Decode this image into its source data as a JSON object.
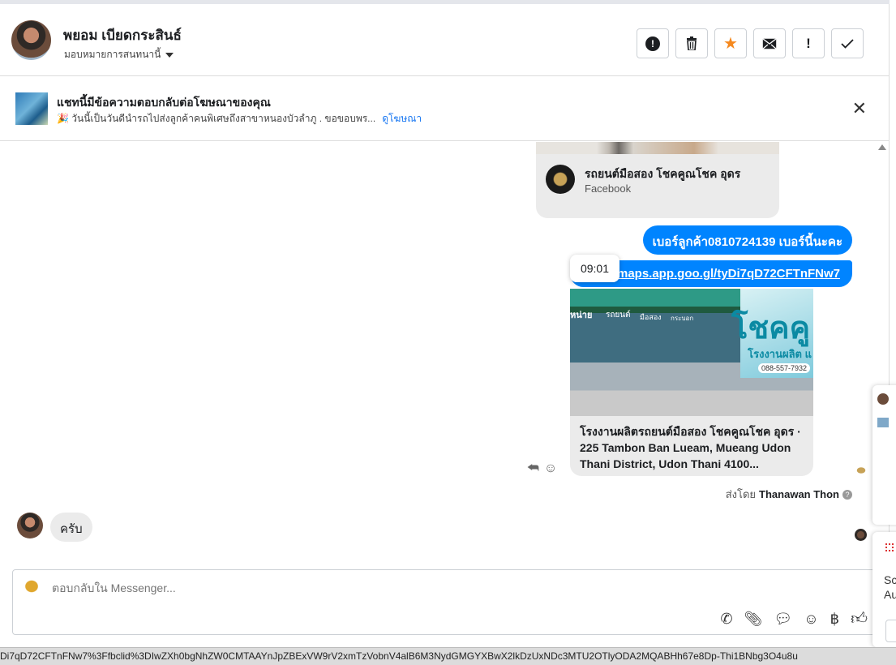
{
  "header": {
    "name": "พยอม เบียดกระสินธ์",
    "assign_label": "มอบหมายการสนทนานี้",
    "actions": [
      {
        "icon": "alert-circle-icon",
        "glyph": "❗"
      },
      {
        "icon": "trash-icon",
        "glyph": "🗑"
      },
      {
        "icon": "star-icon",
        "glyph": "★"
      },
      {
        "icon": "envelope-icon",
        "glyph": "✉"
      },
      {
        "icon": "exclamation-icon",
        "glyph": "!"
      },
      {
        "icon": "check-icon",
        "glyph": "✓"
      }
    ]
  },
  "ad_banner": {
    "title": "แชทนี้มีข้อความตอบกลับต่อโฆษณาของคุณ",
    "text": "🎉 วันนี้เป็นวันดีนำรถไปส่งลูกค้าคนพิเศษถึงสาขาหนองบัวลำภู . ขอขอบพร...",
    "link": "ดูโฆษณา",
    "close": "✕"
  },
  "messages": {
    "card_title": "รถยนต์มือสอง โชคคูณโชค อุดร",
    "card_source": "Facebook",
    "msg_phone": "เบอร์ลูกค้า0810724139 เบอร์นี้นะคะ",
    "msg_link": "https://maps.app.goo.gl/tyDi7qD72CFTnFNw7",
    "tooltip_time": "09:01",
    "link_card_desc": "โรงงานผลิตรถยนต์มือสอง โชคคูณโชค อุดร · 225 Tambon Ban Lueam, Mueang Udon Thani District, Udon Thani 4100...",
    "img_sign_text": "โชคคู",
    "img_sign_sub": "โรงงานผลิต แ",
    "img_phone": "088-557-7932",
    "img_store_labels": [
      "หน่าย",
      "รถยนต์",
      "มือสอง",
      "กระบอก"
    ],
    "sent_by_prefix": "ส่งโดย",
    "sent_by_name": "Thanawan Thon",
    "help": "?",
    "incoming_reply": "ครับ"
  },
  "composer": {
    "placeholder": "ตอบกลับใน Messenger..."
  },
  "status_bar": {
    "url_text": "Di7qD72CFTnFNw7%3Ffbclid%3DIwZXh0bgNhZW0CMTAAYnJpZBExVW9rV2xmTzVobnV4alB6M3NydGMGYXBwX2lkDzUxNDc3MTU2OTlyODA2MQABHh67e8Dp-Thi1BNbg3O4u8u"
  },
  "side_panel": {
    "text_1": "Sc",
    "text_2": "Au"
  }
}
